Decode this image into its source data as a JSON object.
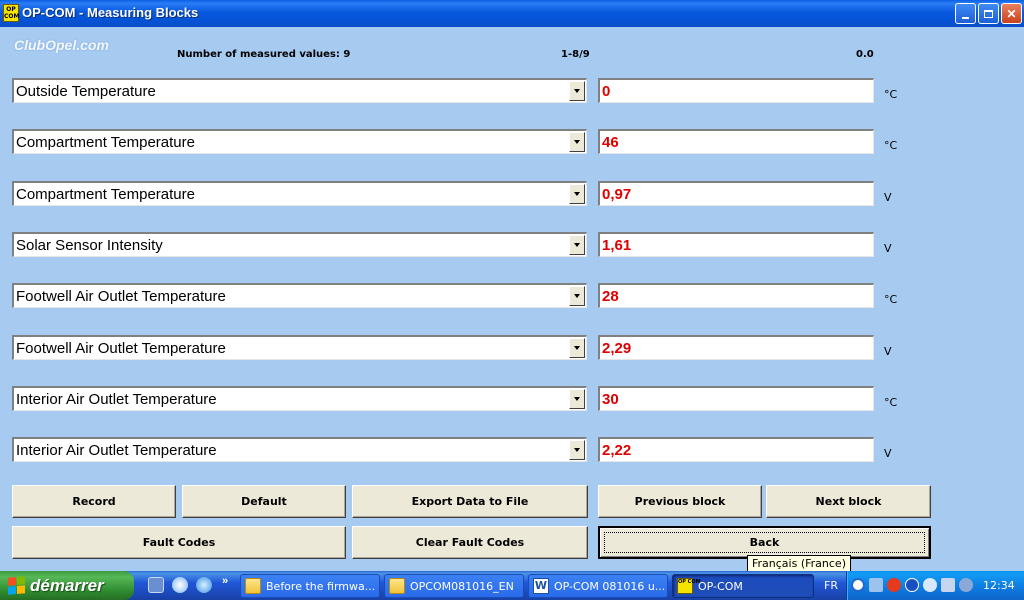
{
  "window": {
    "title": "OP-COM - Measuring Blocks",
    "app_icon_text": "OP COM",
    "watermark": "ClubOpel.com"
  },
  "header": {
    "count_label": "Number of measured values: 9",
    "range": "1-8/9",
    "time": "0.0"
  },
  "rows": [
    {
      "name": "Outside Temperature",
      "value": "0",
      "unit": "°C"
    },
    {
      "name": "Compartment Temperature",
      "value": "46",
      "unit": "°C"
    },
    {
      "name": "Compartment Temperature",
      "value": "0,97",
      "unit": "V"
    },
    {
      "name": "Solar Sensor Intensity",
      "value": "1,61",
      "unit": "V"
    },
    {
      "name": "Footwell Air Outlet Temperature",
      "value": "28",
      "unit": "°C"
    },
    {
      "name": "Footwell Air Outlet Temperature",
      "value": "2,29",
      "unit": "V"
    },
    {
      "name": "Interior Air Outlet Temperature",
      "value": "30",
      "unit": "°C"
    },
    {
      "name": "Interior Air Outlet Temperature",
      "value": "2,22",
      "unit": "V"
    }
  ],
  "buttons": {
    "record": "Record",
    "default": "Default",
    "export": "Export Data to File",
    "previous": "Previous block",
    "next": "Next block",
    "fault_codes": "Fault Codes",
    "clear_fault_codes": "Clear Fault Codes",
    "back": "Back"
  },
  "tooltip": "Français (France)",
  "taskbar": {
    "start_label": "démarrer",
    "more": "»",
    "tasks": [
      {
        "label": "Before the firmwa..."
      },
      {
        "label": "OPCOM081016_EN"
      },
      {
        "label": "OP-COM 081016 u..."
      },
      {
        "label": "OP-COM"
      }
    ],
    "language": "FR",
    "clock": "12:34",
    "word_icon_letter": "W"
  },
  "colors": {
    "background": "#a6caf0",
    "value_text": "#e00000",
    "titlebar": "#0553d6"
  }
}
